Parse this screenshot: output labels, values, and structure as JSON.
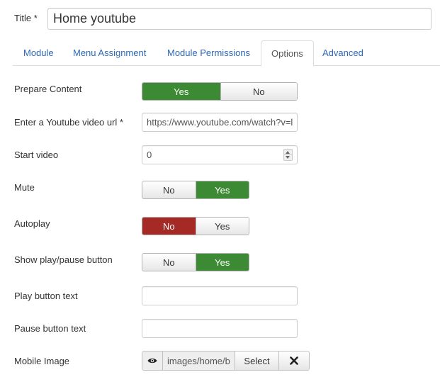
{
  "title_field": {
    "label": "Title *",
    "value": "Home youtube"
  },
  "tabs": [
    {
      "label": "Module",
      "active": false
    },
    {
      "label": "Menu Assignment",
      "active": false
    },
    {
      "label": "Module Permissions",
      "active": false
    },
    {
      "label": "Options",
      "active": true
    },
    {
      "label": "Advanced",
      "active": false
    }
  ],
  "options": {
    "prepare_content": {
      "label": "Prepare Content",
      "yes": "Yes",
      "no": "No",
      "selected": "Yes"
    },
    "youtube_url": {
      "label": "Enter a Youtube video url *",
      "value": "https://www.youtube.com/watch?v=l"
    },
    "start_video": {
      "label": "Start video",
      "value": "0"
    },
    "mute": {
      "label": "Mute",
      "no": "No",
      "yes": "Yes",
      "selected": "Yes"
    },
    "autoplay": {
      "label": "Autoplay",
      "no": "No",
      "yes": "Yes",
      "selected": "No"
    },
    "show_play_pause": {
      "label": "Show play/pause button",
      "no": "No",
      "yes": "Yes",
      "selected": "Yes"
    },
    "play_button_text": {
      "label": "Play button text",
      "value": ""
    },
    "pause_button_text": {
      "label": "Pause button text",
      "value": ""
    },
    "mobile_image": {
      "label": "Mobile Image",
      "value": "images/home/b",
      "select_label": "Select",
      "clear_icon": "close-icon",
      "preview_icon": "eye-icon"
    }
  },
  "colors": {
    "yes_active": "#3d8a34",
    "no_active": "#a52a25",
    "tab_link": "#2a69b8"
  }
}
